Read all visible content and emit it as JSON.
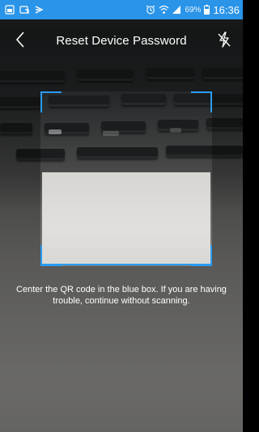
{
  "status_bar": {
    "time": "16:36",
    "battery_percent": "69%",
    "left_icons": [
      "gallery-icon",
      "screenshot-icon",
      "cast-icon"
    ],
    "right_icons": [
      "alarm-icon",
      "wifi-icon",
      "signal-icon",
      "battery-icon"
    ],
    "background_color": "#2a94e8"
  },
  "header": {
    "title": "Reset Device Password",
    "back_icon": "back-chevron-icon",
    "flash_icon": "flash-off-icon"
  },
  "scanner": {
    "frame_color": "#2a9bf0",
    "hint": "Center the QR code in the blue box. If you are having trouble, continue without scanning."
  }
}
